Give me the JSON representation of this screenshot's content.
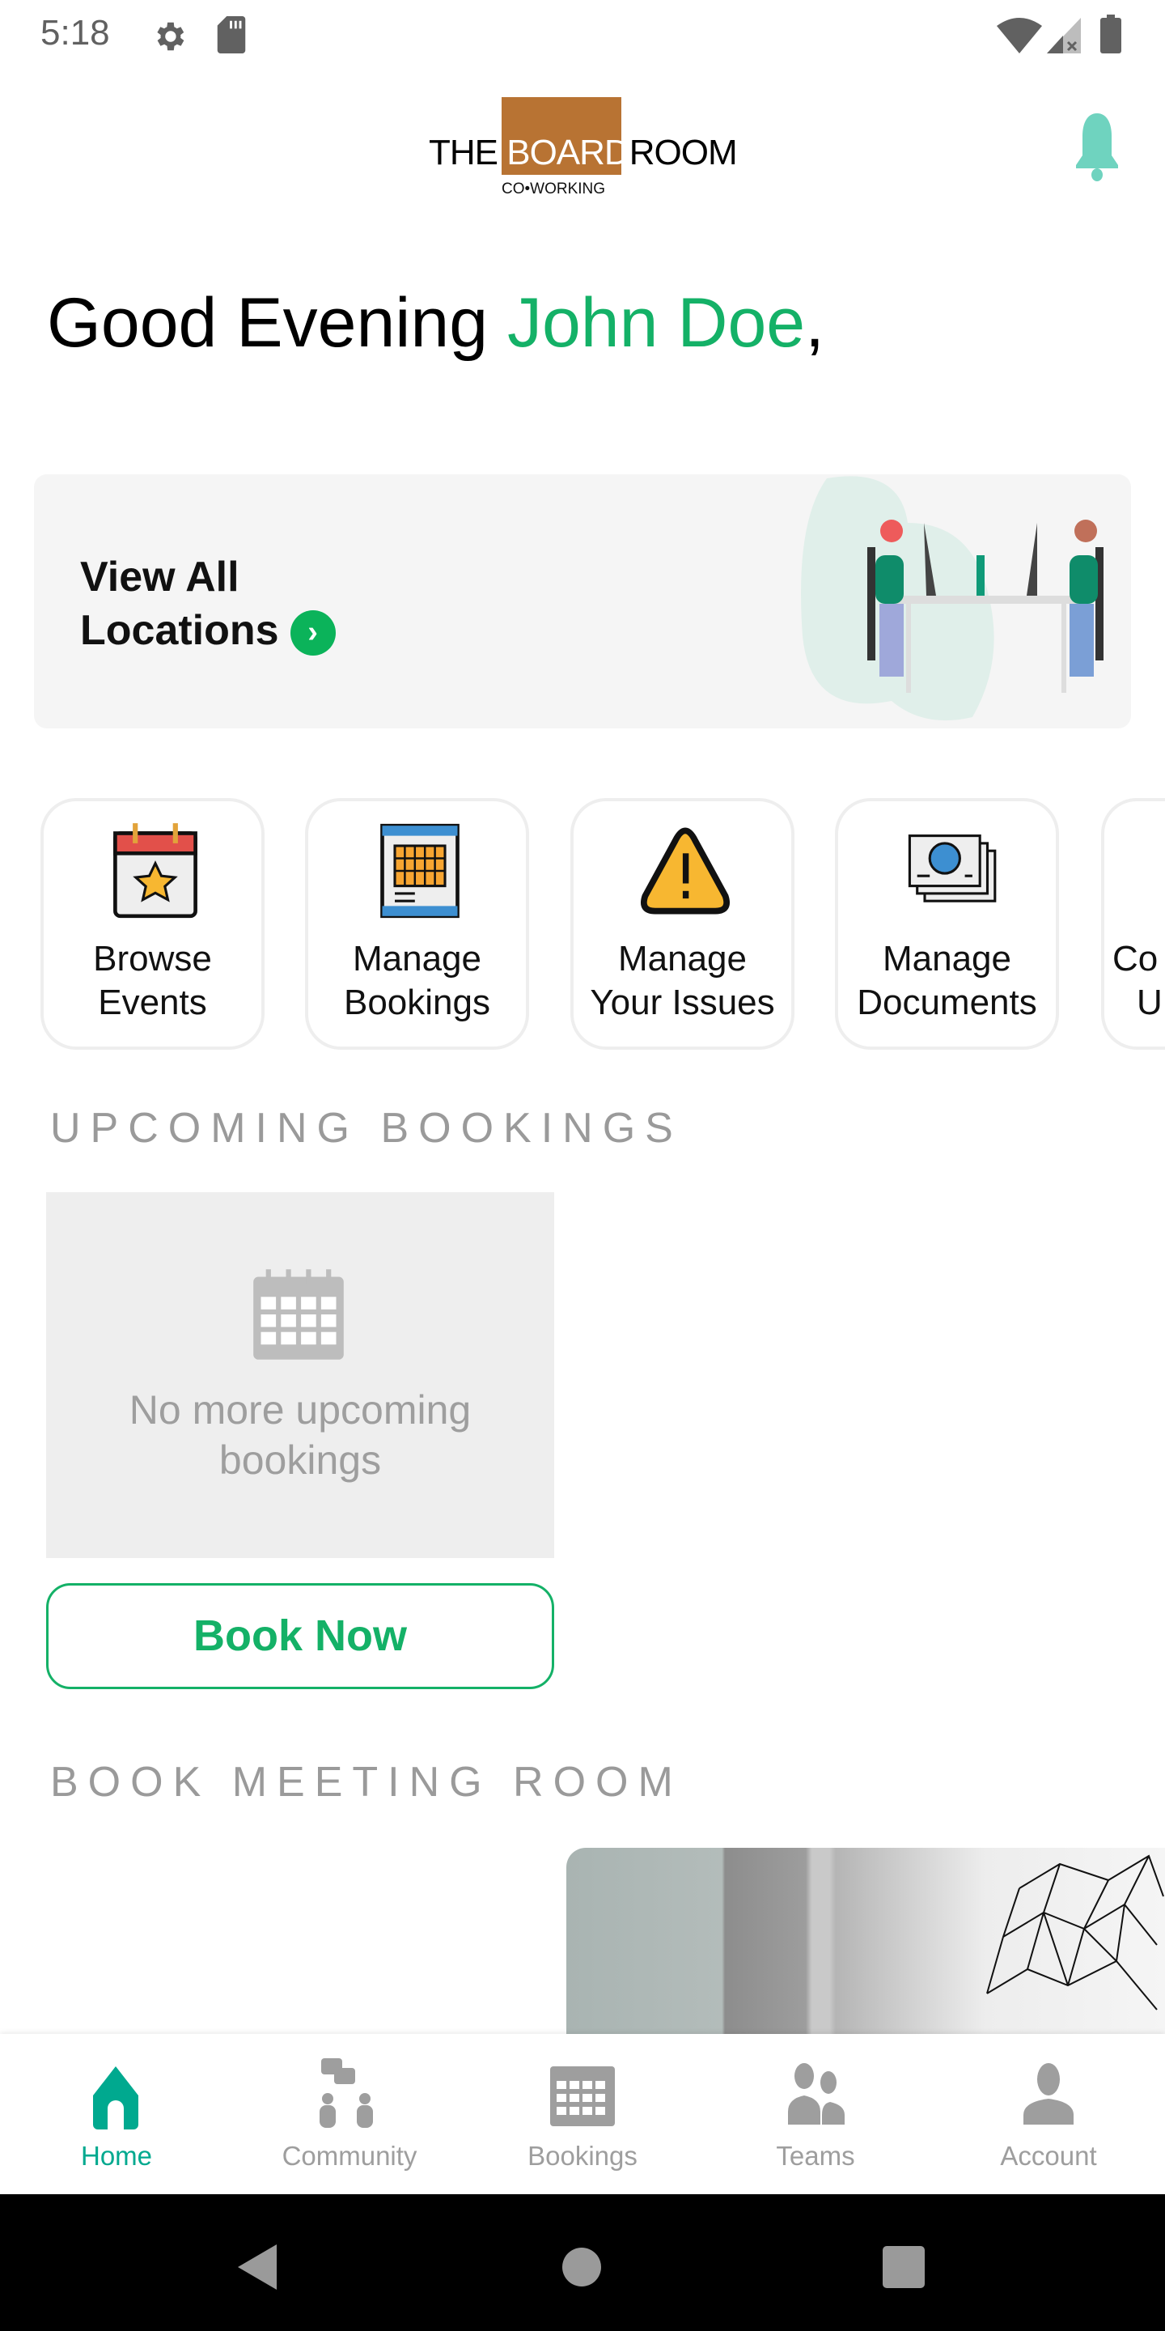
{
  "status_bar": {
    "time": "5:18",
    "icons": [
      "gear-icon",
      "sd-card-icon",
      "wifi-icon",
      "signal-icon",
      "battery-icon"
    ]
  },
  "header": {
    "logo": {
      "text_pre": "THE ",
      "text_highlight": "BOARD",
      "text_post": "ROOM",
      "subtitle": "CO•WORKING"
    },
    "notification_icon": "bell-icon",
    "bell_color": "#6fd3bf"
  },
  "greeting": {
    "prefix": "Good Evening ",
    "name": "John Doe",
    "suffix": ","
  },
  "locations_card": {
    "line1": "View All",
    "line2": "Locations",
    "chevron": "›"
  },
  "quick_actions": [
    {
      "line1": "Browse",
      "line2": "Events",
      "icon": "calendar-star-icon"
    },
    {
      "line1": "Manage",
      "line2": "Bookings",
      "icon": "calendar-grid-icon"
    },
    {
      "line1": "Manage",
      "line2": "Your Issues",
      "icon": "warning-icon"
    },
    {
      "line1": "Manage",
      "line2": "Documents",
      "icon": "id-documents-icon"
    },
    {
      "line1": "Co",
      "line2": "U",
      "icon": ""
    }
  ],
  "upcoming": {
    "title": "UPCOMING BOOKINGS",
    "empty_text": "No more upcoming bookings",
    "book_now": "Book Now"
  },
  "meeting": {
    "title": "BOOK MEETING ROOM"
  },
  "bottom_nav": [
    {
      "label": "Home",
      "icon": "home-icon",
      "active": true
    },
    {
      "label": "Community",
      "icon": "community-icon",
      "active": false
    },
    {
      "label": "Bookings",
      "icon": "calendar-icon",
      "active": false
    },
    {
      "label": "Teams",
      "icon": "teams-icon",
      "active": false
    },
    {
      "label": "Account",
      "icon": "account-icon",
      "active": false
    }
  ],
  "colors": {
    "accent_green": "#14b167",
    "nav_active": "#00a98f",
    "logo_brown": "#b87333"
  }
}
